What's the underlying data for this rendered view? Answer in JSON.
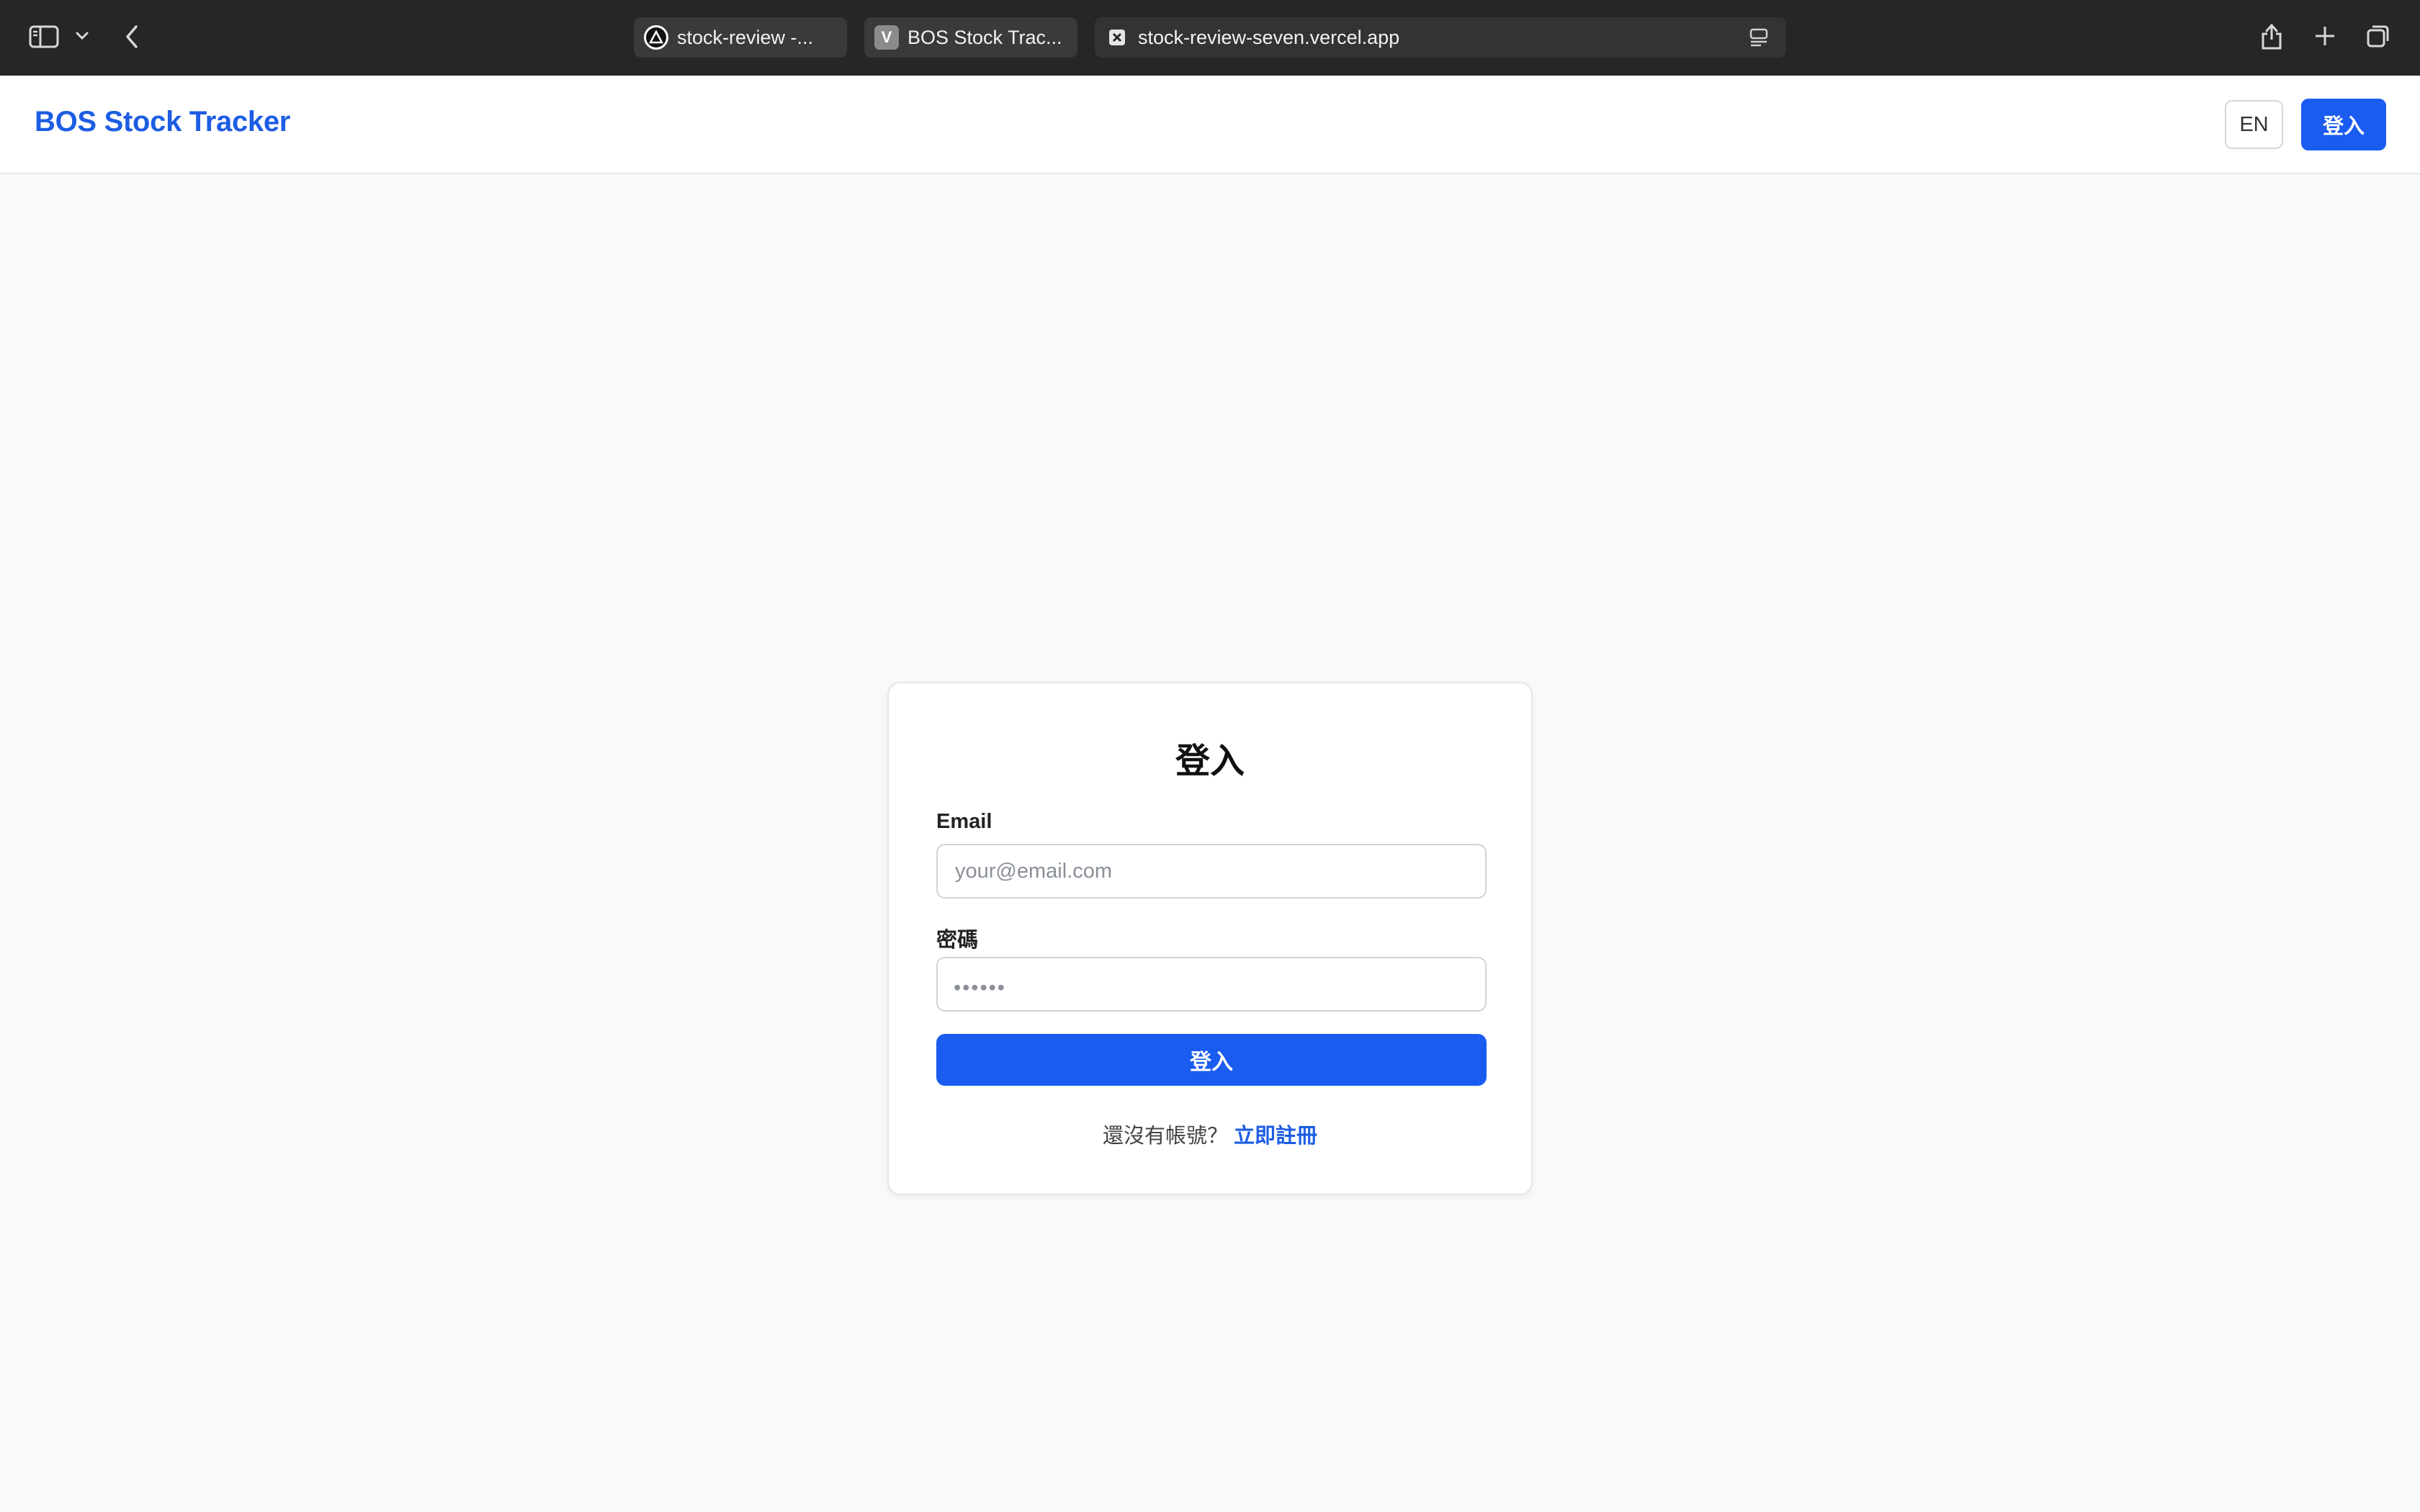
{
  "browser": {
    "tabs": [
      {
        "label": "stock-review -...",
        "icon": "vercel-triangle-icon"
      },
      {
        "label": "BOS Stock Trac...",
        "icon": "v-letter-icon",
        "icon_text": "V"
      },
      {
        "label": "stock-review-seven.vercel.app",
        "icon": "close-box-icon"
      }
    ]
  },
  "header": {
    "brand": "BOS Stock Tracker",
    "lang_button": "EN",
    "login_button": "登入"
  },
  "login": {
    "title": "登入",
    "email_label": "Email",
    "email_placeholder": "your@email.com",
    "password_label": "密碼",
    "password_mask": "••••••",
    "submit": "登入",
    "signup_prompt": "還沒有帳號？",
    "signup_link": "立即註冊"
  },
  "colors": {
    "accent": "#1a5cf0",
    "brand_text": "#1d5de4",
    "page_bg": "#f8f9fb",
    "chrome_bg": "#262626"
  }
}
